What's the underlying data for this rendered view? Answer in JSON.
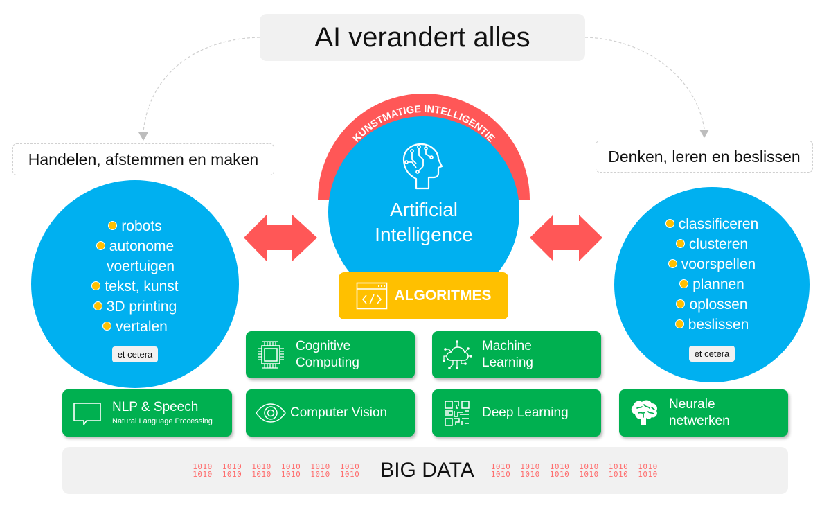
{
  "title": "AI verandert alles",
  "left_label": "Handelen, afstemmen en maken",
  "right_label": "Denken, leren en beslissen",
  "arc_label": "KUNSTMATIGE INTELLIGENTIE",
  "center": {
    "icon": "brain-head-icon",
    "title_line1": "Artificial",
    "title_line2": "Intelligence"
  },
  "algorithms": {
    "icon": "code-window-icon",
    "label": "ALGORITMES"
  },
  "left_circle": {
    "items": [
      "robots",
      "autonome",
      "voertuigen",
      "tekst, kunst",
      "3D printing",
      "vertalen"
    ],
    "etc": "et cetera"
  },
  "right_circle": {
    "items": [
      "classificeren",
      "clusteren",
      "voorspellen",
      "plannen",
      "oplossen",
      "beslissen"
    ],
    "etc": "et cetera"
  },
  "boxes": {
    "cognitive": {
      "line1": "Cognitive",
      "line2": "Computing",
      "icon": "cpu-chip-icon"
    },
    "machine_learning": {
      "line1": "Machine",
      "line2": "Learning",
      "icon": "cloud-network-icon"
    },
    "nlp": {
      "title": "NLP & Speech",
      "subtitle": "Natural Language Processing",
      "icon": "speech-bubble-icon"
    },
    "vision": {
      "label": "Computer Vision",
      "icon": "eye-icon"
    },
    "deep_learning": {
      "label": "Deep Learning",
      "icon": "circuit-maze-icon"
    },
    "neural": {
      "line1": "Neurale",
      "line2": "netwerken",
      "icon": "brain-icon"
    }
  },
  "big_data": {
    "label": "BIG DATA",
    "bit_pattern": "1010"
  },
  "colors": {
    "blue": "#00b0f0",
    "red": "#ff5757",
    "yellow": "#ffc000",
    "green": "#00b050",
    "panel_grey": "#f1f1f1"
  }
}
